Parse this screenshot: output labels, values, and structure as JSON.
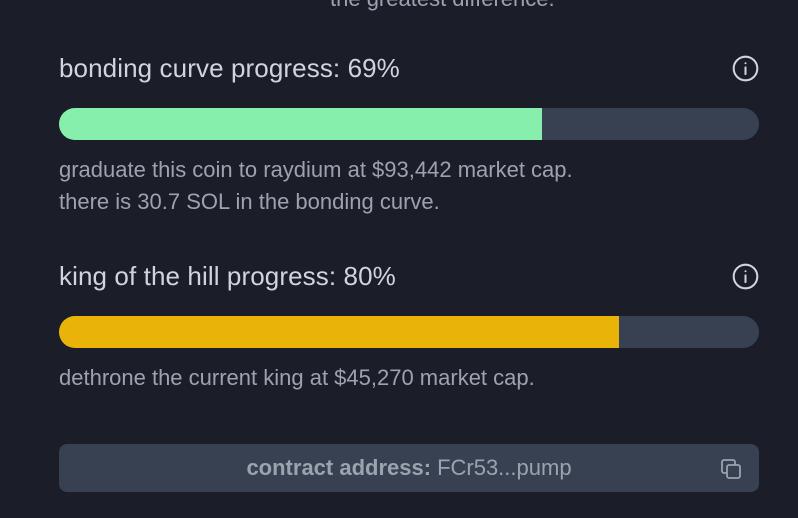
{
  "clipped_text": "the greatest difference.",
  "bonding": {
    "title": "bonding curve progress: 69%",
    "progress": 0.69,
    "color": "#86efac",
    "line1": "graduate this coin to raydium at $93,442 market cap.",
    "line2": "there is 30.7 SOL in the bonding curve.",
    "icon": "info-icon"
  },
  "koth": {
    "title": "king of the hill progress: 80%",
    "progress": 0.8,
    "color": "#eab308",
    "line1": "dethrone the current king at $45,270 market cap.",
    "icon": "info-icon"
  },
  "contract": {
    "label": "contract address:",
    "value": "FCr53...pump",
    "icon": "copy-icon"
  }
}
